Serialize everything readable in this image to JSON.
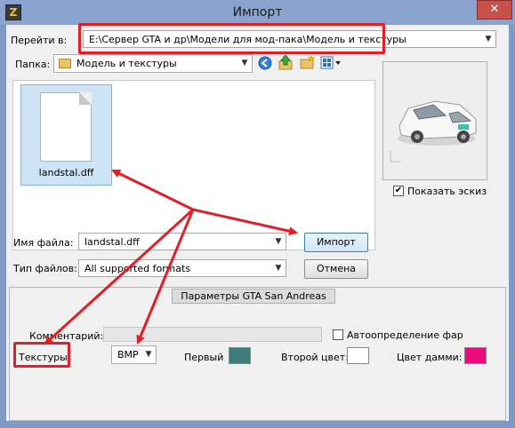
{
  "window": {
    "title": "Импорт",
    "app_icon": "app-icon",
    "close_glyph": "✕"
  },
  "navigate": {
    "label": "Перейти в:",
    "path": "E:\\Сервер GTA и др\\Модели для мод-пака\\Модель и текстуры"
  },
  "folder": {
    "label": "Папка:",
    "value": "Модель и текстуры",
    "toolbar_icons": [
      "back-icon",
      "up-folder-icon",
      "new-folder-icon",
      "view-menu-icon"
    ]
  },
  "files": [
    {
      "name": "landstal.dff",
      "icon": "document-icon",
      "selected": true
    }
  ],
  "preview": {
    "show_label": "Показать эскиз",
    "show_checked": true,
    "image": "car-thumbnail"
  },
  "filename": {
    "label": "Имя файла:",
    "value": "landstal.dff"
  },
  "filetype": {
    "label": "Тип файлов:",
    "value": "All supported formats"
  },
  "buttons": {
    "import": "Импорт",
    "cancel": "Отмена"
  },
  "gta_panel": {
    "header": "Параметры GTA San Andreas",
    "comment_label": "Комментарий:",
    "comment_value": "",
    "autodetect_label": "Автоопределение фар",
    "autodetect_checked": false,
    "textures_label": "Текстуры:",
    "textures_value": "BMP",
    "first_label": "Первый",
    "first_color": "#3f7d78",
    "second_label": "Второй цвет:",
    "second_color": "#ffffff",
    "dummy_label": "Цвет дамми:",
    "dummy_color": "#ea0a7e"
  },
  "annotation_color": "#e01f26"
}
